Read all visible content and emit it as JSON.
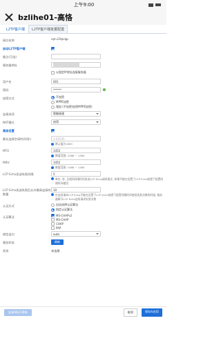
{
  "status": {
    "time": "上午9:00"
  },
  "header": {
    "title": "bzlihe01-高恪"
  },
  "tabs": [
    {
      "label": "L2TP客户端"
    },
    {
      "label": "L2TP客户端批量配置"
    }
  ],
  "form": {
    "rows": [
      {
        "label": "接口名称",
        "value": "vpn.l2tpcqp"
      },
      {
        "label": "启动L2TP客户端"
      },
      {
        "label": "备注(可选)"
      },
      {
        "label": "服务器地址",
        "value": ""
      },
      {
        "label": "",
        "checkbox_label": "以固定IP地址连接服务器"
      },
      {
        "label": "用户名",
        "value": "001"
      },
      {
        "label": "密码",
        "value": "******"
      },
      {
        "label": "加密方式",
        "options": [
          "不加密",
          "MPPE加密",
          "强加 (不加密/加密MPPE加密)"
        ]
      },
      {
        "label": "连接选项",
        "value": "智能接速"
      },
      {
        "label": "NAT模式",
        "value": "启用"
      },
      {
        "label": "高级设置"
      },
      {
        "label": "最长连接空闲时间(秒)",
        "value": "1-65535",
        "hint": "默认值为1800"
      },
      {
        "label": "MTU",
        "value": "1452",
        "hint": "数值范围: 1088 ~ 1460"
      },
      {
        "label": "MRU",
        "value": "1452",
        "hint": "数值范围: 1088 ~ 1460"
      },
      {
        "label": "LCP Echo发送失败间隔",
        "value": "5",
        "hint": "单位: 秒, 且相同间隔时间发送LCP Echo请求报文, 如果不能在设置了LCP Echo前提下配置间隔时间使用"
      },
      {
        "label": "LCP Echo发送失败后允许最高连接的数量",
        "value": "10",
        "hint": "在连续请求LCP Echo不能在设置了LCP Echo前提下配置间隔时间使用失败次数的时候, 服务器断开LCP Echo连续请求失败次数"
      },
      {
        "label": "认证方式",
        "options": [
          "自动选择认证算法",
          "指定认证算法"
        ]
      },
      {
        "label": "认证算法",
        "checks": [
          "MS-CHAPv2",
          "MS-CHAP",
          "CHAP",
          "PAP"
        ]
      },
      {
        "label": "绑定出口",
        "value": "auto"
      },
      {
        "label": "服务状态",
        "button": "刷新"
      },
      {
        "label": "状态",
        "value": "未连接"
      }
    ]
  },
  "footer": {
    "left_button": "连接/断开/更新",
    "cancel": "取消",
    "save": "保存&应用"
  }
}
